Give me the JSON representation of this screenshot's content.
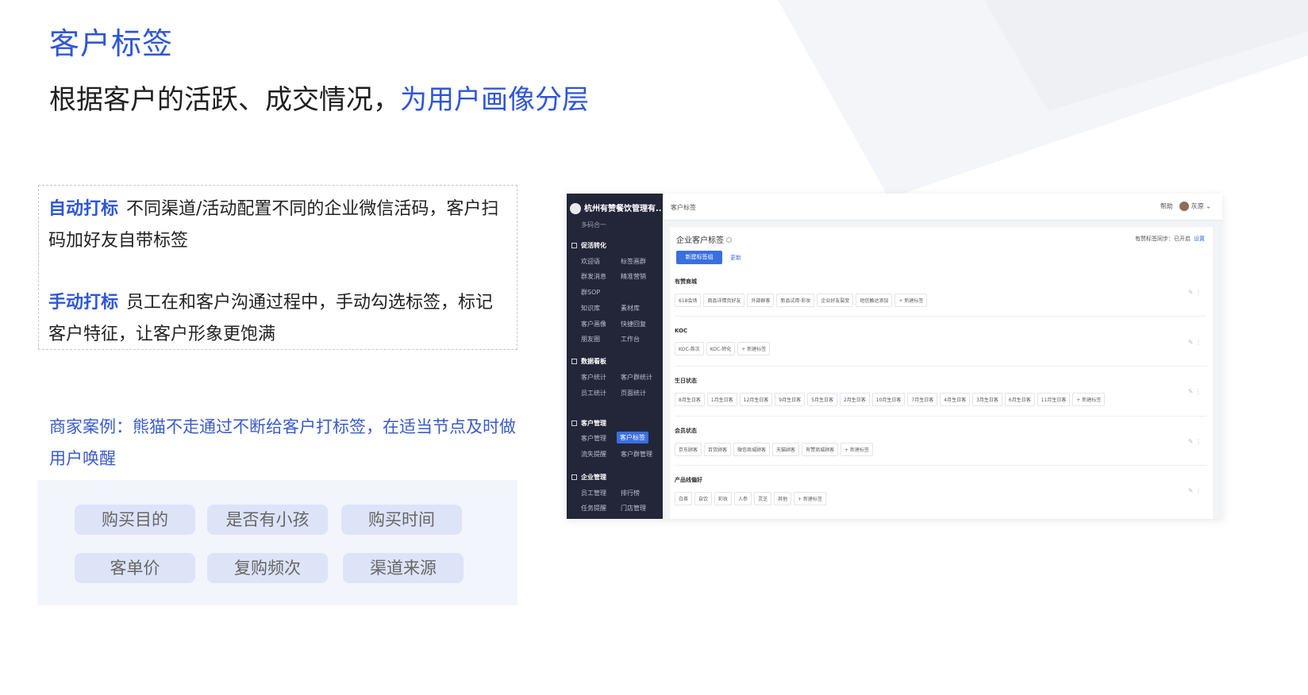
{
  "header": {
    "title": "客户标签",
    "subtitle_main": "根据客户的活跃、成交情况，",
    "subtitle_highlight": "为用户画像分层"
  },
  "tagging": {
    "auto_label": "自动打标",
    "auto_text": "不同渠道/活动配置不同的企业微信活码，客户扫码加好友自带标签",
    "manual_label": "手动打标",
    "manual_text": "员工在和客户沟通过程中，手动勾选标签，标记客户特征，让客户形象更饱满"
  },
  "case_text": "商家案例：熊猫不走通过不断给客户打标签，在适当节点及时做用户唤醒",
  "chips": [
    "购买目的",
    "是否有小孩",
    "购买时间",
    "客单价",
    "复购频次",
    "渠道来源"
  ],
  "app": {
    "brand": "杭州有赞餐饮管理有...",
    "brand_sub": "多码合一",
    "sections": [
      {
        "title": "促活转化",
        "items": [
          "欢迎语",
          "标签画群",
          "群发消息",
          "精准营销",
          "群SOP",
          "知识库",
          "素材库",
          "客户画像",
          "快捷回复",
          "朋友圈",
          "工作台"
        ]
      },
      {
        "title": "数据看板",
        "items": [
          "客户统计",
          "客户群统计",
          "员工统计",
          "页面统计"
        ]
      },
      {
        "title": "客户管理",
        "items": [
          "客户管理",
          "客户标签",
          "流失提醒",
          "客户群管理"
        ]
      },
      {
        "title": "企业管理",
        "items": [
          "员工管理",
          "排行榜",
          "任务提醒",
          "门店管理"
        ]
      }
    ],
    "active_item": "客户标签",
    "breadcrumb": "客户标签",
    "top_right": {
      "help": "帮助",
      "user": "灰原"
    },
    "content_title": "企业客户标签",
    "sync_text": "有赞标签同步：已开启",
    "sync_link": "设置",
    "new_group_button": "新建标签组",
    "refresh_link": "更新",
    "add_tag_label": "+ 新建标签",
    "groups": [
      {
        "name": "有赞商城",
        "tags": [
          "618会场",
          "商品详情页好友",
          "外部群客",
          "新品试用·彩妆",
          "企业好友裂变",
          "短信触达添加"
        ]
      },
      {
        "name": "KOC",
        "tags": [
          "KOC-首次",
          "KOC-转化"
        ]
      },
      {
        "name": "生日状态",
        "tags": [
          "8月生日客",
          "1月生日客",
          "12月生日客",
          "9月生日客",
          "5月生日客",
          "2月生日客",
          "10月生日客",
          "7月生日客",
          "4月生日客",
          "3月生日客",
          "6月生日客",
          "11月生日客"
        ]
      },
      {
        "name": "会员状态",
        "tags": [
          "京东顾客",
          "百货顾客",
          "微信商城顾客",
          "天猫顾客",
          "有赞商城顾客"
        ]
      },
      {
        "name": "产品线偏好",
        "tags": [
          "白茶",
          "自饮",
          "彩妆",
          "人参",
          "灵芝",
          "其他"
        ]
      }
    ]
  }
}
